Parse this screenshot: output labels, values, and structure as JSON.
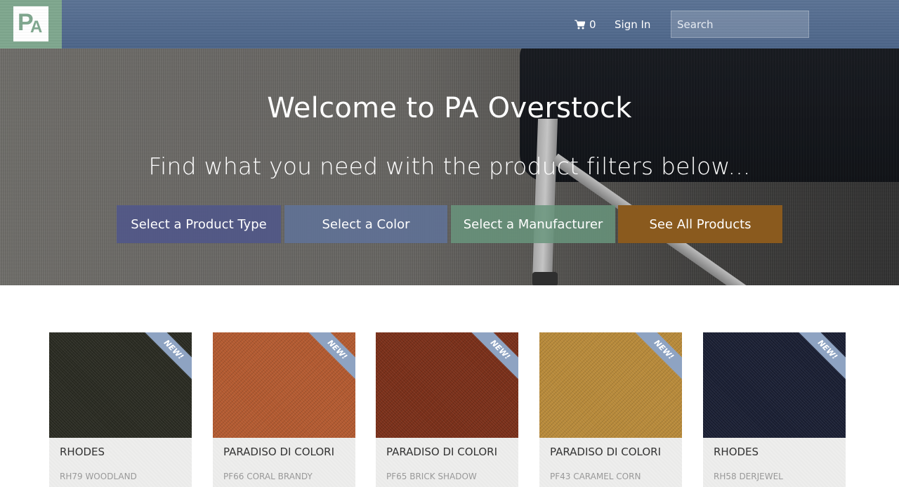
{
  "header": {
    "logo_text": "PA",
    "cart_count": "0",
    "signin_label": "Sign In",
    "search_placeholder": "Search",
    "colors": {
      "bar": "#5b7394",
      "logo_bg": "#7fa78e"
    }
  },
  "hero": {
    "title": "Welcome to PA Overstock",
    "subtitle": "Find what you need with the product filters below...",
    "filters": [
      {
        "label": "Select a Product Type",
        "color": "#4e558c"
      },
      {
        "label": "Select a Color",
        "color": "#5f739b"
      },
      {
        "label": "Select a Manufacturer",
        "color": "#68957d"
      },
      {
        "label": "See All Products",
        "color": "#8a5a1e"
      }
    ]
  },
  "products": [
    {
      "name": "RHODES",
      "code": "RH79 WOODLAND",
      "badge": "NEW!",
      "swatch_color": "#2a2b22"
    },
    {
      "name": "PARADISO DI COLORI",
      "code": "PF66 CORAL BRANDY",
      "badge": "NEW!",
      "swatch_color": "#b35a30"
    },
    {
      "name": "PARADISO DI COLORI",
      "code": "PF65 BRICK SHADOW",
      "badge": "NEW!",
      "swatch_color": "#7a2f19"
    },
    {
      "name": "PARADISO DI COLORI",
      "code": "PF43 CARAMEL CORN",
      "badge": "NEW!",
      "swatch_color": "#b88a3a"
    },
    {
      "name": "RHODES",
      "code": "RH58 DERJEWEL",
      "badge": "NEW!",
      "swatch_color": "#1a1f33"
    }
  ]
}
